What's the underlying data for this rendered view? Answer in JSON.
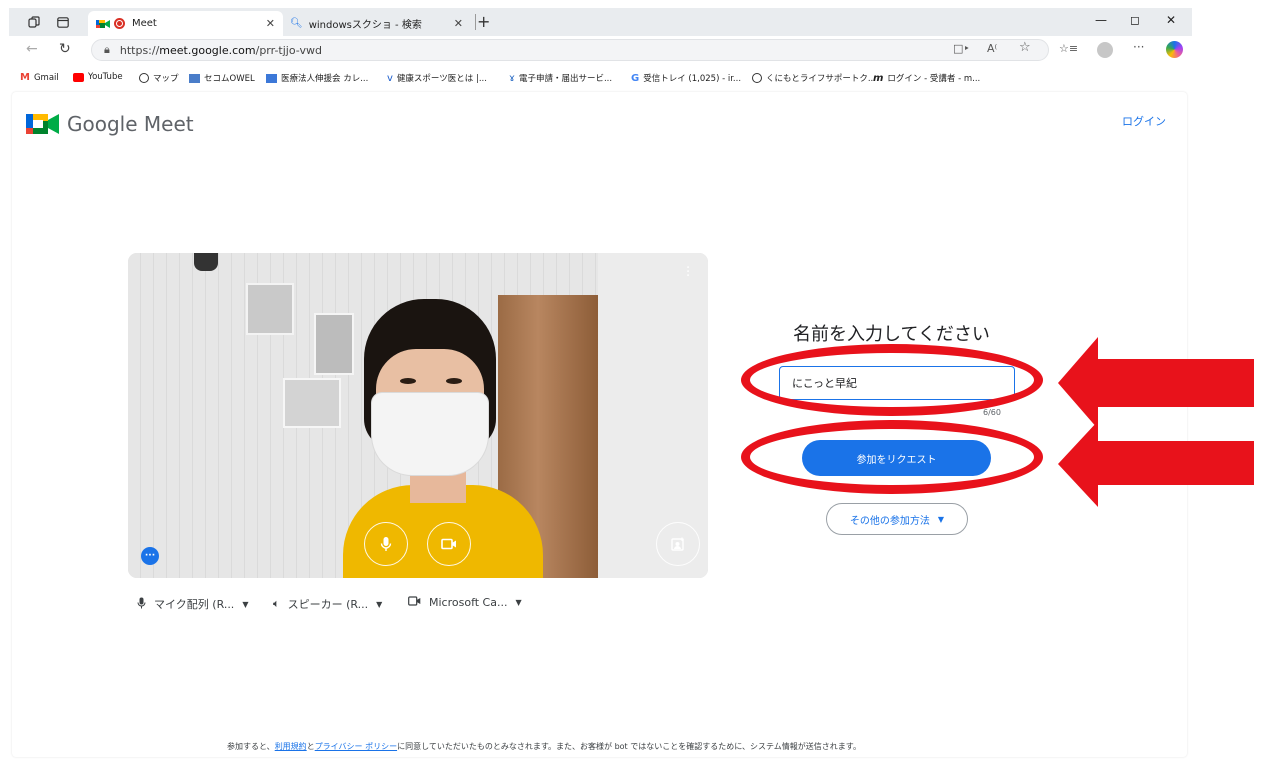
{
  "browser": {
    "tabs": [
      {
        "title": "Meet",
        "active": true
      },
      {
        "title": "windowsスクショ - 検索",
        "active": false
      }
    ],
    "url_scheme": "https://",
    "url_host": "meet.google.com",
    "url_path": "/prr-tjjo-vwd",
    "bookmarks": [
      "Gmail",
      "YouTube",
      "マップ",
      "セコムOWEL",
      "医療法人伸援会 カレ...",
      "健康スポーツ医とは |...",
      "電子申請・届出サービ...",
      "受信トレイ (1,025) - ir...",
      "くにもとライフサポートク...",
      "ログイン - 受講者 - m..."
    ]
  },
  "meet": {
    "logo_text": "Google Meet",
    "login_label": "ログイン",
    "join_title": "名前を入力してください",
    "name_value": "にこっと早紀",
    "name_counter": "6/60",
    "join_button": "参加をリクエスト",
    "other_join_button": "その他の参加方法",
    "devices": {
      "mic": "マイク配列 (R...",
      "speaker": "スピーカー (R...",
      "camera": "Microsoft Ca..."
    },
    "footer": {
      "pre": "参加すると、",
      "terms": "利用規約",
      "mid": "と",
      "privacy": "プライバシー ポリシー",
      "post": "に同意していただいたものとみなされます。また、お客様が bot ではないことを確認するために、システム情報が送信されます。"
    }
  },
  "colors": {
    "accent": "#1a73e8",
    "annotation": "#e8121b"
  }
}
